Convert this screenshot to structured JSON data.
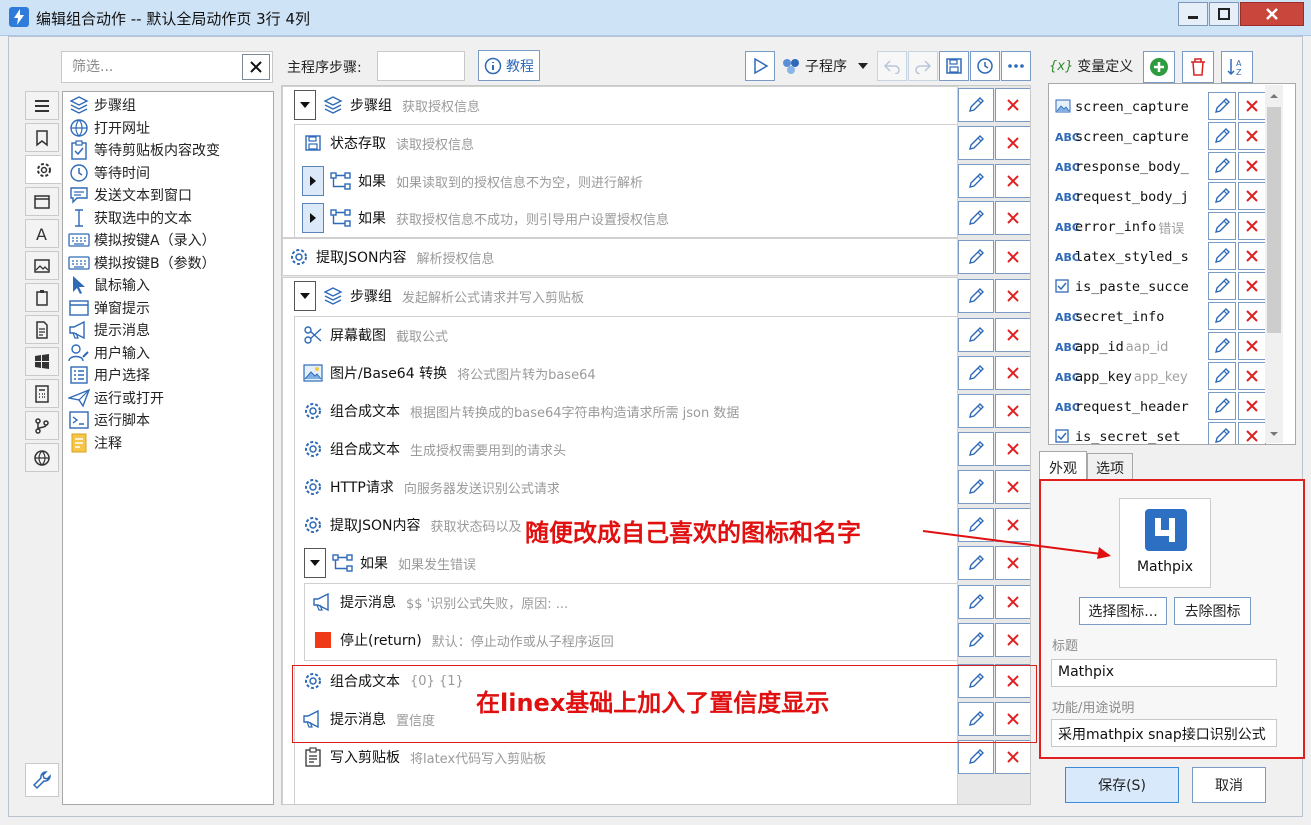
{
  "window": {
    "title": "编辑组合动作 -- 默认全局动作页 3行 4列"
  },
  "filter": {
    "placeholder": "筛选..."
  },
  "sidebar": {
    "items": [
      {
        "label": "步骤组",
        "icon": "layers-icon"
      },
      {
        "label": "打开网址",
        "icon": "globe-icon"
      },
      {
        "label": "等待剪贴板内容改变",
        "icon": "clipboard-check-icon"
      },
      {
        "label": "等待时间",
        "icon": "clock-icon"
      },
      {
        "label": "发送文本到窗口",
        "icon": "message-icon"
      },
      {
        "label": "获取选中的文本",
        "icon": "text-cursor-icon"
      },
      {
        "label": "模拟按键A（录入）",
        "icon": "keyboard-icon"
      },
      {
        "label": "模拟按键B（参数）",
        "icon": "keyboard-icon"
      },
      {
        "label": "鼠标输入",
        "icon": "cursor-icon"
      },
      {
        "label": "弹窗提示",
        "icon": "popup-icon"
      },
      {
        "label": "提示消息",
        "icon": "megaphone-icon"
      },
      {
        "label": "用户输入",
        "icon": "user-edit-icon"
      },
      {
        "label": "用户选择",
        "icon": "list-icon"
      },
      {
        "label": "运行或打开",
        "icon": "paper-plane-icon"
      },
      {
        "label": "运行脚本",
        "icon": "terminal-icon"
      },
      {
        "label": "注释",
        "icon": "note-icon"
      }
    ]
  },
  "toolbar": {
    "main_steps_label": "主程序步骤:",
    "main_steps_value": "",
    "tutorial_label": "教程",
    "subprogram_label": "子程序"
  },
  "steps": [
    {
      "name": "步骤组",
      "desc": "获取授权信息",
      "icon": "layers-icon"
    },
    {
      "name": "状态存取",
      "desc": "读取授权信息",
      "icon": "save-icon"
    },
    {
      "name": "如果",
      "desc": "如果读取到的授权信息不为空，则进行解析",
      "icon": "branch-icon"
    },
    {
      "name": "如果",
      "desc": "获取授权信息不成功，则引导用户设置授权信息",
      "icon": "branch-icon"
    },
    {
      "name": "提取JSON内容",
      "desc": "解析授权信息",
      "icon": "gear-icon"
    },
    {
      "name": "步骤组",
      "desc": "发起解析公式请求并写入剪贴板",
      "icon": "layers-icon"
    },
    {
      "name": "屏幕截图",
      "desc": "截取公式",
      "icon": "scissors-icon"
    },
    {
      "name": "图片/Base64 转换",
      "desc": "将公式图片转为base64",
      "icon": "image-icon"
    },
    {
      "name": "组合成文本",
      "desc": "根据图片转换成的base64字符串构造请求所需 json 数据",
      "icon": "gear-icon"
    },
    {
      "name": "组合成文本",
      "desc": "生成授权需要用到的请求头",
      "icon": "gear-icon"
    },
    {
      "name": "HTTP请求",
      "desc": "向服务器发送识别公式请求",
      "icon": "gear-icon"
    },
    {
      "name": "提取JSON内容",
      "desc": "获取状态码以及",
      "icon": "gear-icon"
    },
    {
      "name": "如果",
      "desc": "如果发生错误",
      "icon": "branch-icon"
    },
    {
      "name": "提示消息",
      "desc": "$$ '识别公式失败，原因: ...",
      "icon": "megaphone-icon"
    },
    {
      "name": "停止(return)",
      "desc": "默认：停止动作或从子程序返回",
      "icon": "stop-icon"
    },
    {
      "name": "组合成文本",
      "desc": "{0} {1}",
      "icon": "gear-icon"
    },
    {
      "name": "提示消息",
      "desc": "置信度",
      "icon": "megaphone-icon"
    },
    {
      "name": "写入剪贴板",
      "desc": "将latex代码写入剪贴板",
      "icon": "clipboard-icon"
    }
  ],
  "variables": {
    "title": "变量定义",
    "badge": "{x}",
    "items": [
      {
        "type": "image",
        "name": "screen_capture",
        "hint": ""
      },
      {
        "type": "ABC",
        "name": "screen_capture",
        "hint": ""
      },
      {
        "type": "ABC",
        "name": "response_body_",
        "hint": ""
      },
      {
        "type": "ABC",
        "name": "request_body_j",
        "hint": ""
      },
      {
        "type": "ABC",
        "name": "error_info",
        "hint": "错误"
      },
      {
        "type": "ABC",
        "name": "latex_styled_s",
        "hint": ""
      },
      {
        "type": "check",
        "name": "is_paste_succe",
        "hint": ""
      },
      {
        "type": "ABC",
        "name": "secret_info",
        "hint": ""
      },
      {
        "type": "ABC",
        "name": "app_id",
        "hint": "aap_id"
      },
      {
        "type": "ABC",
        "name": "app_key",
        "hint": "app_key"
      },
      {
        "type": "ABC",
        "name": "request_header",
        "hint": ""
      },
      {
        "type": "check",
        "name": "is_secret_set",
        "hint": ""
      }
    ]
  },
  "panel": {
    "tab_appearance": "外观",
    "tab_options": "选项",
    "icon_label": "Mathpix",
    "choose_icon": "选择图标...",
    "remove_icon": "去除图标",
    "title_label": "标题",
    "title_value": "Mathpix",
    "desc_label": "功能/用途说明",
    "desc_value": "采用mathpix snap接口识别公式"
  },
  "buttons": {
    "save": "保存(S)",
    "cancel": "取消"
  },
  "annotations": {
    "icon_hint": "随便改成自己喜欢的图标和名字",
    "linex_hint": "在linex基础上加入了置信度显示"
  },
  "colors": {
    "accent": "#2f6ab8",
    "danger": "#e02020",
    "titlebar": "#cfe3f7"
  }
}
